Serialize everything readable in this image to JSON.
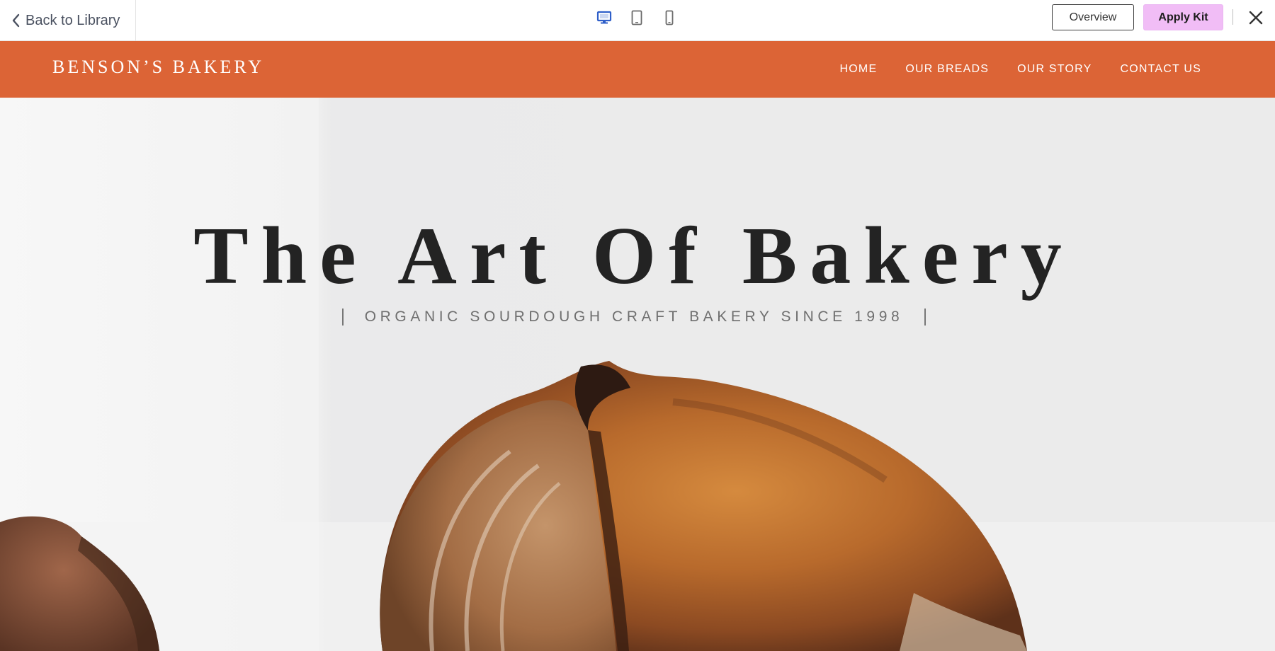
{
  "toolbar": {
    "back_label": "Back to Library",
    "devices": [
      {
        "icon": "desktop-icon",
        "active": true
      },
      {
        "icon": "tablet-icon",
        "active": false
      },
      {
        "icon": "mobile-icon",
        "active": false
      }
    ],
    "overview_label": "Overview",
    "apply_label": "Apply Kit",
    "close_icon": "close-icon"
  },
  "site": {
    "logo": "BENSON’S BAKERY",
    "nav": [
      "HOME",
      "OUR BREADS",
      "OUR STORY",
      "CONTACT US"
    ]
  },
  "hero": {
    "title": "The Art Of Bakery",
    "subtitle": "ORGANIC SOURDOUGH CRAFT BAKERY SINCE 1998"
  },
  "colors": {
    "header_bg": "#dc6436",
    "apply_bg": "#f1bdf6",
    "active_device": "#2f5fc9",
    "inactive_device": "#6b6b6b"
  }
}
